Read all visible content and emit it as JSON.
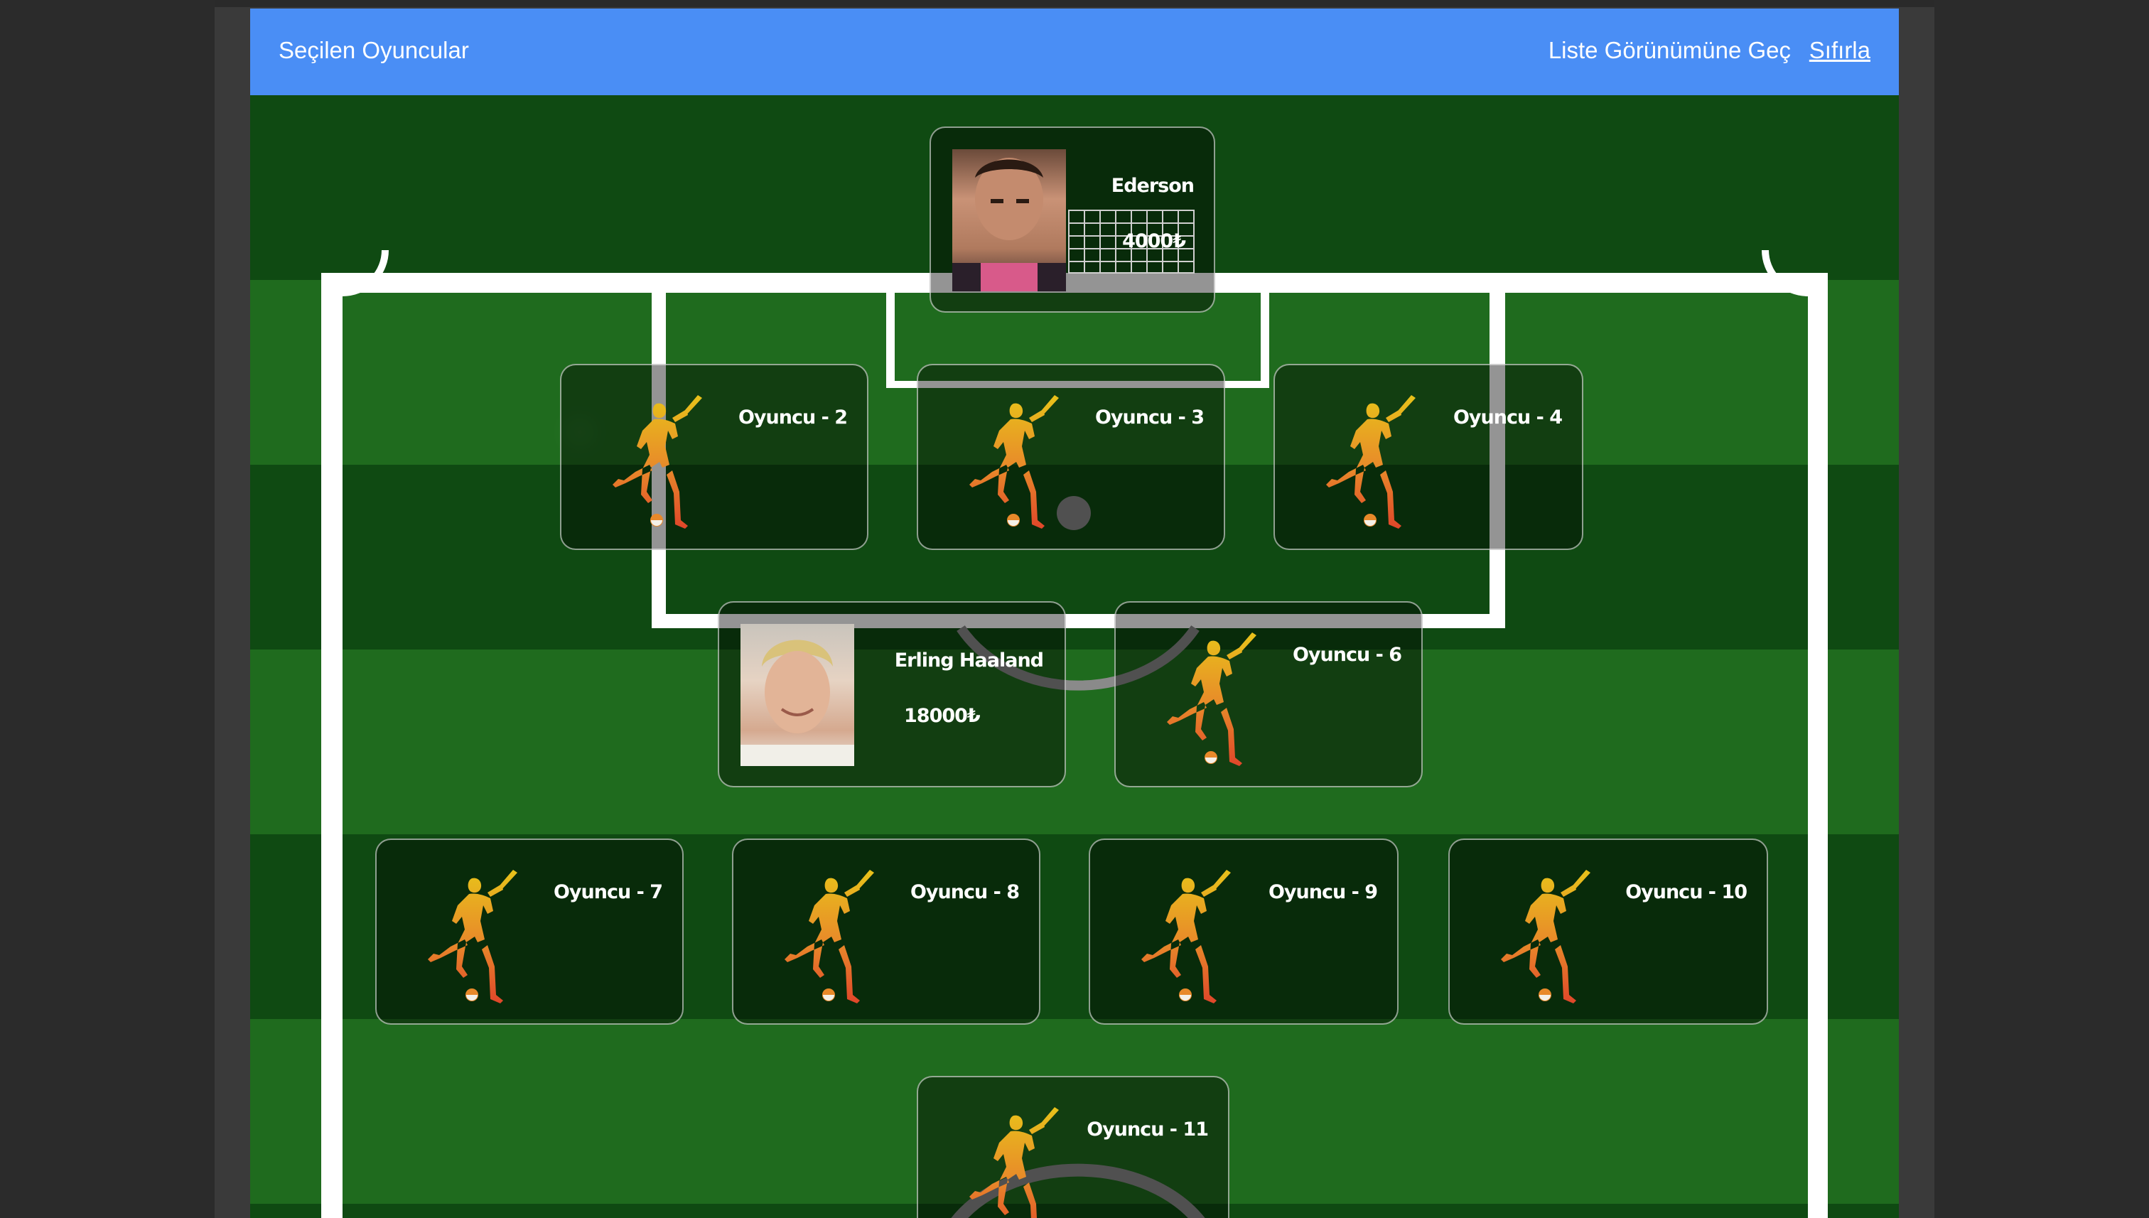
{
  "header": {
    "title": "Seçilen Oyuncular",
    "switch_view": "Liste Görünümüne Geç",
    "reset": "Sıfırla"
  },
  "goalkeeper": {
    "name": "Ederson",
    "price": "4000₺"
  },
  "row1": [
    {
      "name": "Oyuncu - 2"
    },
    {
      "name": "Oyuncu - 3"
    },
    {
      "name": "Oyuncu - 4"
    }
  ],
  "row2": [
    {
      "name": "Erling Haaland",
      "price": "18000₺"
    },
    {
      "name": "Oyuncu - 6"
    }
  ],
  "row3": [
    {
      "name": "Oyuncu - 7"
    },
    {
      "name": "Oyuncu - 8"
    },
    {
      "name": "Oyuncu - 9"
    },
    {
      "name": "Oyuncu - 10"
    }
  ],
  "row4": [
    {
      "name": "Oyuncu - 11"
    }
  ],
  "colors": {
    "header_bg": "#4a8ef5",
    "pitch_dark": "#0f4a12",
    "pitch_light": "#1f6b1e"
  },
  "icons": {
    "empty_slot": "football-player-silhouette-icon"
  }
}
